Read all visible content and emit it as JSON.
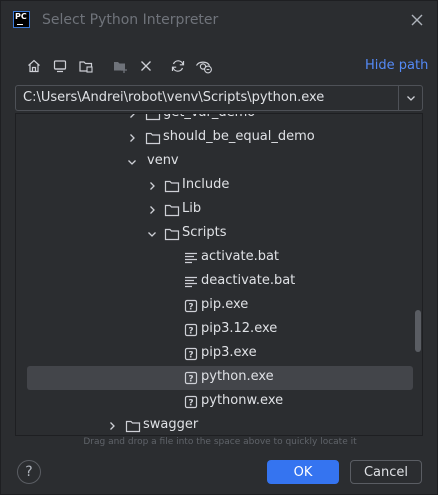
{
  "dialog": {
    "app_icon_text": "PC",
    "title": "Select Python Interpreter"
  },
  "toolbar": {
    "buttons": [
      "home-icon",
      "desktop-icon",
      "project-folder-icon",
      "new-folder-icon",
      "delete-icon",
      "refresh-icon",
      "show-hidden-icon"
    ],
    "hide_path_label": "Hide path"
  },
  "path": {
    "value": "C:\\Users\\Andrei\\robot\\venv\\Scripts\\python.exe"
  },
  "tree": {
    "rows": [
      {
        "label": "get_var_demo",
        "type": "folder",
        "expanded": false
      },
      {
        "label": "should_be_equal_demo",
        "type": "folder",
        "expanded": false
      },
      {
        "label": "venv",
        "type": "none",
        "expanded": true
      },
      {
        "label": "Include",
        "type": "folder",
        "expanded": false
      },
      {
        "label": "Lib",
        "type": "folder",
        "expanded": false
      },
      {
        "label": "Scripts",
        "type": "folder",
        "expanded": true
      },
      {
        "label": "activate.bat",
        "type": "text-file"
      },
      {
        "label": "deactivate.bat",
        "type": "text-file"
      },
      {
        "label": "pip.exe",
        "type": "unknown-file"
      },
      {
        "label": "pip3.12.exe",
        "type": "unknown-file"
      },
      {
        "label": "pip3.exe",
        "type": "unknown-file"
      },
      {
        "label": "python.exe",
        "type": "unknown-file",
        "selected": true
      },
      {
        "label": "pythonw.exe",
        "type": "unknown-file"
      },
      {
        "label": "swagger",
        "type": "folder",
        "expanded": false
      }
    ]
  },
  "hint": "Drag and drop a file into the space above to quickly locate it",
  "buttons": {
    "help": "?",
    "ok": "OK",
    "cancel": "Cancel"
  },
  "colors": {
    "accent": "#3574f0",
    "link": "#548af7",
    "background": "#2b2d30",
    "selection": "#43454a"
  }
}
